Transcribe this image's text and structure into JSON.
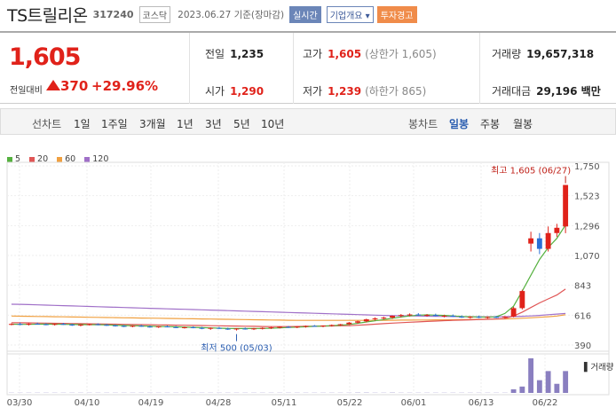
{
  "header": {
    "name": "TS트릴리온",
    "code": "317240",
    "market": "코스닥",
    "date": "2023.06.27 기준(장마감)",
    "realtime": "실시간",
    "company_info": "기업개요 ▾",
    "warning": "투자경고"
  },
  "summary": {
    "price": "1,605",
    "change_label": "전일대비",
    "change": "370",
    "change_pct": "+29.96%",
    "prev_close_label": "전일",
    "prev_close": "1,235",
    "open_label": "시가",
    "open": "1,290",
    "high_label": "고가",
    "high": "1,605",
    "high_note": "(상한가 1,605)",
    "low_label": "저가",
    "low": "1,239",
    "low_note": "(하한가 865)",
    "volume_label": "거래량",
    "volume": "19,657,318",
    "amount_label": "거래대금",
    "amount": "29,196 백만"
  },
  "tabs": {
    "line_label": "선차트",
    "line_items": [
      "1일",
      "1주일",
      "3개월",
      "1년",
      "3년",
      "5년",
      "10년"
    ],
    "candle_label": "봉차트",
    "candle_items": [
      "일봉",
      "주봉",
      "월봉"
    ],
    "selected_candle": "일봉"
  },
  "legend": [
    {
      "label": "5",
      "color": "#55b13f"
    },
    {
      "label": "20",
      "color": "#e05555"
    },
    {
      "label": "60",
      "color": "#f0a040"
    },
    {
      "label": "120",
      "color": "#a070c8"
    }
  ],
  "chart_data": {
    "type": "candlestick",
    "y_ticks": [
      "1,750",
      "1,523",
      "1,296",
      "1,070",
      "843",
      "616",
      "390"
    ],
    "ylim": [
      390,
      1750
    ],
    "x_ticks": [
      "03/30",
      "04/10",
      "04/19",
      "04/28",
      "05/11",
      "05/22",
      "06/01",
      "06/13",
      "06/22"
    ],
    "annotation_high": "최고 1,605 (06/27)",
    "annotation_low": "최저 500 (05/03)",
    "volume_label": "거래량",
    "candles": [
      [
        545,
        555,
        540,
        550
      ],
      [
        550,
        560,
        540,
        545
      ],
      [
        545,
        556,
        538,
        552
      ],
      [
        552,
        560,
        545,
        548
      ],
      [
        548,
        555,
        540,
        546
      ],
      [
        546,
        553,
        538,
        550
      ],
      [
        550,
        558,
        543,
        545
      ],
      [
        545,
        552,
        535,
        540
      ],
      [
        540,
        548,
        532,
        544
      ],
      [
        544,
        552,
        538,
        548
      ],
      [
        548,
        555,
        540,
        543
      ],
      [
        543,
        550,
        535,
        539
      ],
      [
        539,
        546,
        530,
        535
      ],
      [
        535,
        542,
        526,
        532
      ],
      [
        532,
        540,
        525,
        536
      ],
      [
        536,
        543,
        528,
        530
      ],
      [
        530,
        538,
        522,
        527
      ],
      [
        527,
        535,
        520,
        531
      ],
      [
        531,
        538,
        524,
        526
      ],
      [
        526,
        534,
        518,
        522
      ],
      [
        522,
        530,
        515,
        525
      ],
      [
        525,
        532,
        517,
        520
      ],
      [
        520,
        528,
        510,
        515
      ],
      [
        515,
        524,
        505,
        520
      ],
      [
        520,
        527,
        512,
        514
      ],
      [
        514,
        522,
        505,
        510
      ],
      [
        510,
        518,
        500,
        515
      ],
      [
        515,
        523,
        507,
        512
      ],
      [
        512,
        520,
        504,
        516
      ],
      [
        516,
        524,
        508,
        520
      ],
      [
        520,
        528,
        512,
        524
      ],
      [
        524,
        532,
        516,
        528
      ],
      [
        528,
        535,
        520,
        526
      ],
      [
        526,
        534,
        518,
        530
      ],
      [
        530,
        538,
        522,
        535
      ],
      [
        535,
        542,
        528,
        532
      ],
      [
        532,
        540,
        525,
        538
      ],
      [
        538,
        546,
        530,
        542
      ],
      [
        542,
        550,
        535,
        548
      ],
      [
        548,
        565,
        542,
        560
      ],
      [
        560,
        575,
        552,
        570
      ],
      [
        570,
        590,
        562,
        585
      ],
      [
        585,
        600,
        575,
        592
      ],
      [
        592,
        605,
        583,
        598
      ],
      [
        598,
        615,
        588,
        612
      ],
      [
        612,
        625,
        600,
        618
      ],
      [
        618,
        630,
        608,
        622
      ],
      [
        622,
        632,
        612,
        615
      ],
      [
        615,
        625,
        605,
        618
      ],
      [
        618,
        628,
        608,
        610
      ],
      [
        610,
        620,
        600,
        612
      ],
      [
        612,
        622,
        602,
        605
      ],
      [
        605,
        615,
        596,
        600
      ],
      [
        600,
        610,
        590,
        604
      ],
      [
        604,
        614,
        594,
        598
      ],
      [
        598,
        608,
        590,
        603
      ],
      [
        603,
        612,
        594,
        600
      ],
      [
        600,
        610,
        592,
        606
      ],
      [
        606,
        680,
        600,
        670
      ],
      [
        670,
        810,
        660,
        800
      ],
      [
        1160,
        1250,
        1100,
        1200
      ],
      [
        1200,
        1240,
        1080,
        1120
      ],
      [
        1120,
        1290,
        1100,
        1240
      ],
      [
        1240,
        1310,
        1210,
        1280
      ],
      [
        1290,
        1605,
        1239,
        1605
      ]
    ],
    "volumes": [
      0.2,
      0.2,
      0.2,
      0.2,
      0.2,
      0.2,
      0.2,
      0.2,
      0.2,
      0.2,
      0.2,
      0.2,
      0.2,
      0.2,
      0.2,
      0.2,
      0.2,
      0.2,
      0.2,
      0.2,
      0.2,
      0.2,
      0.2,
      0.2,
      0.2,
      0.2,
      0.2,
      0.2,
      0.2,
      0.2,
      0.2,
      0.2,
      0.2,
      0.2,
      0.2,
      0.2,
      0.2,
      0.2,
      0.2,
      0.2,
      0.3,
      0.3,
      0.2,
      0.2,
      0.3,
      0.2,
      0.2,
      0.2,
      0.2,
      0.2,
      0.2,
      0.2,
      0.2,
      0.2,
      0.2,
      0.2,
      0.2,
      0.2,
      4,
      7,
      38,
      14,
      24,
      10,
      24
    ],
    "ma5": [
      548,
      547,
      547,
      548,
      548,
      548,
      547,
      546,
      545,
      545,
      544,
      543,
      540,
      538,
      537,
      535,
      533,
      531,
      530,
      528,
      526,
      524,
      522,
      520,
      518,
      516,
      515,
      515,
      515,
      516,
      518,
      520,
      523,
      526,
      529,
      532,
      534,
      537,
      540,
      546,
      555,
      565,
      574,
      583,
      593,
      603,
      611,
      617,
      619,
      617,
      615,
      611,
      607,
      605,
      603,
      602,
      604,
      630,
      685,
      800,
      920,
      1040,
      1130,
      1200,
      1300
    ],
    "ma20": [
      560,
      559,
      558,
      557,
      556,
      555,
      554,
      553,
      552,
      551,
      550,
      549,
      548,
      547,
      546,
      545,
      544,
      543,
      542,
      541,
      540,
      539,
      538,
      537,
      536,
      535,
      534,
      533,
      532,
      531,
      530,
      530,
      530,
      531,
      532,
      533,
      534,
      535,
      536,
      537,
      540,
      544,
      548,
      552,
      556,
      560,
      563,
      566,
      569,
      572,
      575,
      577,
      579,
      581,
      583,
      585,
      587,
      592,
      610,
      640,
      675,
      710,
      740,
      770,
      815
    ],
    "ma60": [
      610,
      609,
      608,
      607,
      606,
      605,
      604,
      603,
      602,
      601,
      600,
      599,
      598,
      597,
      596,
      595,
      594,
      593,
      592,
      591,
      590,
      589,
      588,
      587,
      586,
      585,
      584,
      583,
      582,
      581,
      580,
      579,
      578,
      577,
      577,
      577,
      577,
      577,
      577,
      577,
      577,
      577,
      577,
      578,
      578,
      579,
      579,
      580,
      580,
      581,
      581,
      582,
      583,
      584,
      585,
      586,
      587,
      588,
      590,
      593,
      597,
      601,
      605,
      610,
      620
    ],
    "ma120": [
      700,
      699,
      697,
      695,
      693,
      691,
      689,
      687,
      685,
      683,
      681,
      679,
      677,
      675,
      673,
      671,
      669,
      667,
      665,
      663,
      661,
      659,
      657,
      655,
      653,
      651,
      649,
      647,
      645,
      643,
      641,
      639,
      637,
      635,
      633,
      631,
      629,
      627,
      625,
      623,
      621,
      619,
      617,
      615,
      613,
      612,
      611,
      610,
      609,
      608,
      607,
      606,
      605,
      604,
      604,
      604,
      604,
      605,
      606,
      608,
      611,
      615,
      620,
      625,
      630
    ]
  }
}
